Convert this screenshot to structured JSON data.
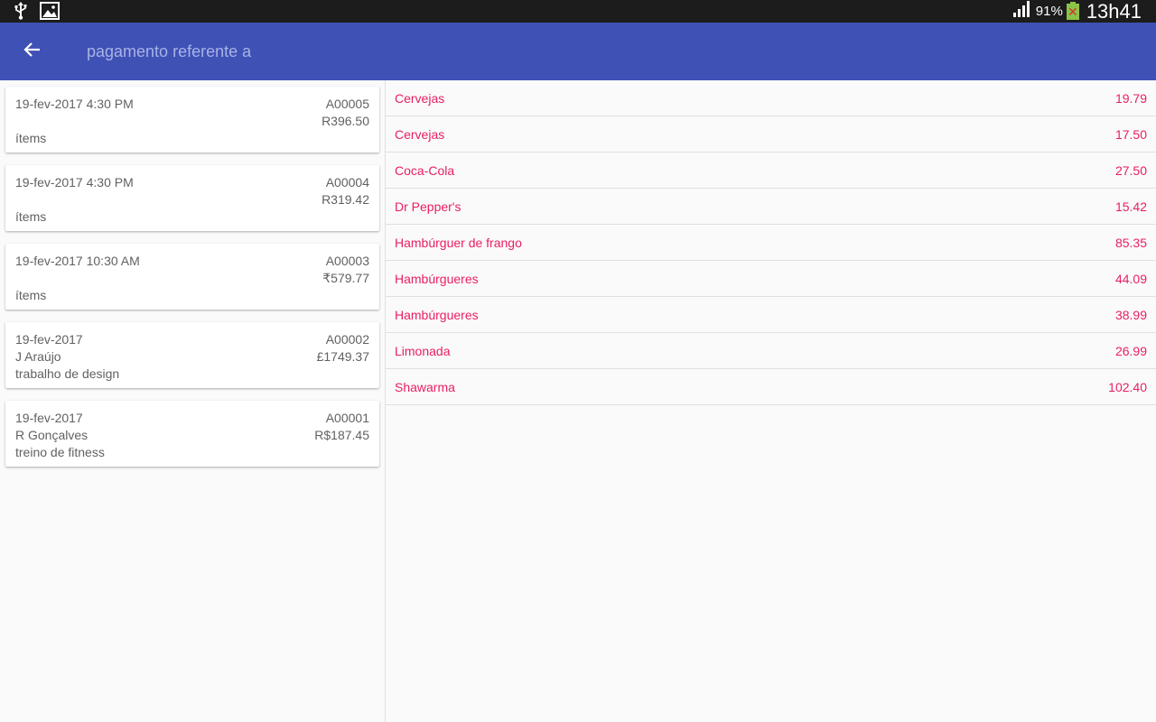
{
  "status_bar": {
    "battery_percent": "91%",
    "time": "13h41",
    "icons": [
      "usb-icon",
      "image-notification-icon",
      "signal-icon",
      "battery-icon"
    ]
  },
  "app_bar": {
    "title": "pagamento referente a",
    "back_icon": "arrow-back-icon",
    "color": "#3f51b5"
  },
  "invoices": [
    {
      "date": "19-fev-2017  4:30 PM",
      "number": "A00005",
      "amount": "R396.50",
      "line2": "",
      "line3": "ítems"
    },
    {
      "date": "19-fev-2017  4:30 PM",
      "number": "A00004",
      "amount": "R319.42",
      "line2": "",
      "line3": "ítems"
    },
    {
      "date": "19-fev-2017  10:30 AM",
      "number": "A00003",
      "amount": "₹579.77",
      "line2": "",
      "line3": "ítems"
    },
    {
      "date": "19-fev-2017",
      "number": "A00002",
      "amount": "£1749.37",
      "line2": "J Araújo",
      "line3": "trabalho de design"
    },
    {
      "date": "19-fev-2017",
      "number": "A00001",
      "amount": "R$187.45",
      "line2": "R Gonçalves",
      "line3": "treino de fitness"
    }
  ],
  "items": [
    {
      "name": "Cervejas",
      "price": "19.79"
    },
    {
      "name": "Cervejas",
      "price": "17.50"
    },
    {
      "name": "Coca-Cola",
      "price": "27.50"
    },
    {
      "name": "Dr Pepper's",
      "price": "15.42"
    },
    {
      "name": "Hambúrguer de frango",
      "price": "85.35"
    },
    {
      "name": "Hambúrgueres",
      "price": "44.09"
    },
    {
      "name": "Hambúrgueres",
      "price": "38.99"
    },
    {
      "name": "Limonada",
      "price": "26.99"
    },
    {
      "name": "Shawarma",
      "price": "102.40"
    }
  ],
  "colors": {
    "accent": "#e91e63",
    "primary": "#3f51b5",
    "text_secondary": "#616161"
  }
}
